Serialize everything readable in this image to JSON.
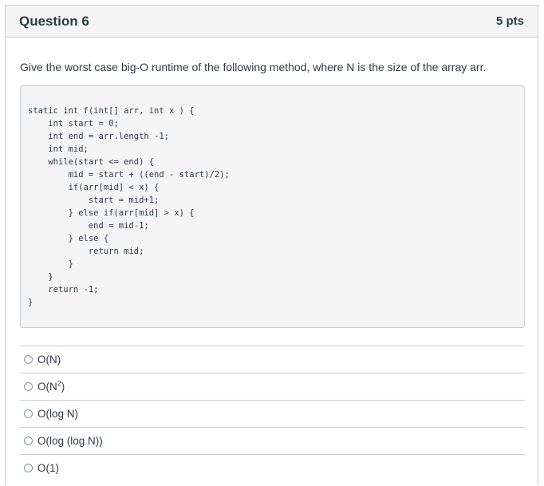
{
  "question": {
    "title": "Question 6",
    "points": "5 pts",
    "text": "Give the worst case big-O runtime of the following method, where N is the size of the array arr.",
    "code": "static int f(int[] arr, int x ) {\n    int start = 0;\n    int end = arr.length -1;\n    int mid;\n    while(start <= end) {\n        mid = start + ((end - start)/2);\n        if(arr[mid] < x) {\n            start = mid+1;\n        } else if(arr[mid] > x) {\n            end = mid-1;\n        } else {\n            return mid;\n        }\n    }\n    return -1;\n}"
  },
  "answers": [
    {
      "label": "O(N)"
    },
    {
      "label": "O(N",
      "sup": "2",
      "suffix": ")"
    },
    {
      "label": "O(log N)"
    },
    {
      "label": "O(log (log N))"
    },
    {
      "label": "O(1)"
    }
  ]
}
